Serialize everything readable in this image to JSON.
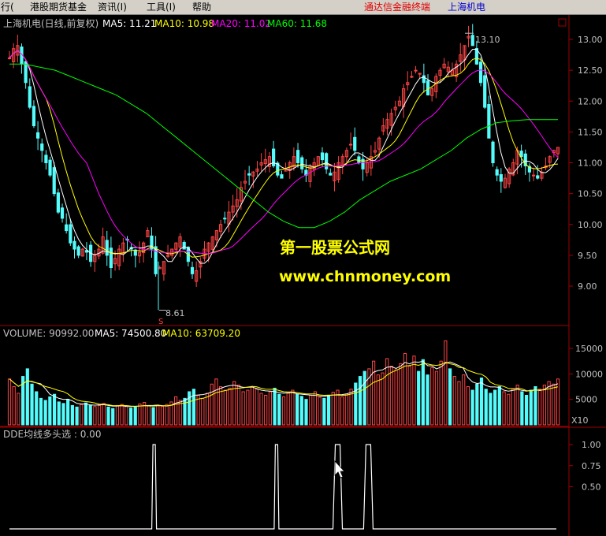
{
  "menu": {
    "items": [
      "行(",
      "港股期货基金",
      "资讯(I)",
      "工具(I)",
      "帮助"
    ],
    "right_links": [
      "通达信金融终端",
      "上海机电"
    ]
  },
  "price_panel": {
    "stock_label": "上海机电(日线,前复权)",
    "ma_labels": [
      "MA5: 11.21",
      "MA10: 10.98",
      "MA20: 11.02",
      "MA60: 11.68"
    ],
    "y_ticks": [
      "13.00",
      "12.50",
      "12.00",
      "11.50",
      "11.00",
      "10.50",
      "10.00",
      "9.50",
      "9.00"
    ],
    "high_label": "13.10",
    "low_label": "8.61",
    "low_marker": "S"
  },
  "volume_panel": {
    "label_values": [
      "VOLUME: 90992.00",
      "MA5: 74500.80",
      "MA10: 63709.20"
    ],
    "y_ticks": [
      "15000",
      "10000",
      "5000"
    ],
    "unit": "X10"
  },
  "indicator_panel": {
    "label": "DDE均线多头选 : 0.00",
    "y_ticks": [
      "1.00",
      "0.75",
      "0.50"
    ]
  },
  "watermark": {
    "line1": "第一股票公式网",
    "line2": "www.chnmoney.com"
  },
  "colors": {
    "up": "#ff4444",
    "down": "#54fcfc",
    "ma5": "#ffffff",
    "ma10": "#ffff00",
    "ma20": "#ff00ff",
    "ma60": "#00ff00",
    "axis": "#a00000",
    "watermark": "#ffff00"
  },
  "chart_data": [
    {
      "type": "candlestick",
      "title": "上海机电(日线,前复权)",
      "ylim": [
        8.6,
        13.2
      ],
      "annotations": [
        {
          "text": "13.10",
          "value": 13.1
        },
        {
          "text": "8.61",
          "value": 8.61
        }
      ],
      "close_path": [
        12.7,
        12.85,
        12.9,
        12.6,
        12.3,
        11.9,
        11.6,
        11.4,
        11.2,
        11.0,
        10.8,
        10.5,
        10.2,
        10.1,
        9.9,
        9.7,
        9.6,
        9.5,
        9.6,
        9.55,
        9.4,
        9.5,
        9.6,
        9.8,
        9.5,
        9.3,
        9.45,
        9.6,
        9.7,
        9.75,
        9.6,
        9.5,
        9.55,
        9.7,
        9.9,
        9.6,
        9.2,
        9.3,
        9.4,
        9.5,
        9.6,
        9.7,
        9.8,
        9.6,
        9.4,
        9.2,
        9.25,
        9.4,
        9.6,
        9.7,
        9.8,
        9.9,
        10.0,
        10.1,
        10.2,
        10.3,
        10.4,
        10.6,
        10.7,
        10.8,
        10.85,
        10.9,
        11.0,
        11.05,
        11.1,
        10.95,
        10.8,
        10.75,
        10.9,
        11.0,
        11.1,
        11.0,
        10.9,
        10.8,
        10.95,
        11.0,
        11.1,
        11.05,
        10.9,
        10.8,
        10.85,
        11.0,
        11.1,
        11.2,
        11.3,
        11.2,
        11.0,
        10.9,
        11.0,
        11.1,
        11.2,
        11.4,
        11.6,
        11.7,
        11.8,
        11.9,
        12.0,
        12.2,
        12.3,
        12.4,
        12.5,
        12.45,
        12.3,
        12.1,
        12.2,
        12.4,
        12.5,
        12.6,
        12.55,
        12.5,
        12.6,
        12.75,
        12.9,
        13.05,
        12.9,
        12.6,
        12.3,
        11.9,
        11.4,
        11.0,
        10.8,
        10.7,
        10.75,
        10.9,
        11.0,
        11.2,
        11.1,
        10.95,
        10.85,
        10.8,
        10.75,
        10.85,
        10.95,
        11.1,
        11.2,
        11.25
      ],
      "ma60_path": [
        12.6,
        12.6,
        12.55,
        12.5,
        12.4,
        12.3,
        12.2,
        12.1,
        11.95,
        11.8,
        11.6,
        11.4,
        11.2,
        11.0,
        10.8,
        10.6,
        10.4,
        10.2,
        10.05,
        9.95,
        9.95,
        10.05,
        10.2,
        10.4,
        10.55,
        10.7,
        10.8,
        10.9,
        11.05,
        11.2,
        11.4,
        11.55,
        11.65,
        11.68,
        11.7,
        11.7,
        11.7
      ]
    },
    {
      "type": "bar",
      "title": "VOLUME",
      "ylim": [
        0,
        18000
      ],
      "values": [
        9000,
        7500,
        6200,
        9500,
        11000,
        8000,
        6500,
        5200,
        4800,
        5500,
        6000,
        4500,
        4200,
        5000,
        3800,
        3500,
        4000,
        4300,
        3900,
        3600,
        3800,
        4200,
        3500,
        3200,
        3800,
        4000,
        3600,
        3300,
        3500,
        4100,
        4400,
        3700,
        3400,
        3800,
        3600,
        4000,
        4500,
        5500,
        4800,
        5200,
        6500,
        7000,
        5800,
        5200,
        6200,
        8000,
        9000,
        7500,
        6800,
        7200,
        8500,
        7800,
        6500,
        6800,
        7500,
        7000,
        6200,
        5800,
        6500,
        7200,
        6000,
        5500,
        6200,
        6800,
        6000,
        5600,
        5000,
        5800,
        6500,
        5400,
        5200,
        5800,
        6400,
        6800,
        5500,
        6000,
        7000,
        8200,
        9500,
        10500,
        11000,
        12500,
        9800,
        10200,
        13000,
        11500,
        10800,
        12000,
        14000,
        11500,
        13500,
        10500,
        12800,
        9800,
        11200,
        10500,
        12500,
        16500,
        11000,
        9500,
        8500,
        9800,
        7500,
        6800,
        8000,
        9200,
        7000,
        6200,
        6800,
        7500,
        6500,
        6000,
        7000,
        7800,
        6500,
        5800,
        6800,
        7500,
        7000,
        7800,
        8500,
        8000,
        9000
      ]
    },
    {
      "type": "line",
      "title": "DDE均线多头选",
      "ylim": [
        0,
        1.05
      ],
      "signal_positions": [
        0.26,
        0.48,
        0.59,
        0.645
      ],
      "values": [
        1,
        1,
        1,
        1
      ]
    }
  ]
}
